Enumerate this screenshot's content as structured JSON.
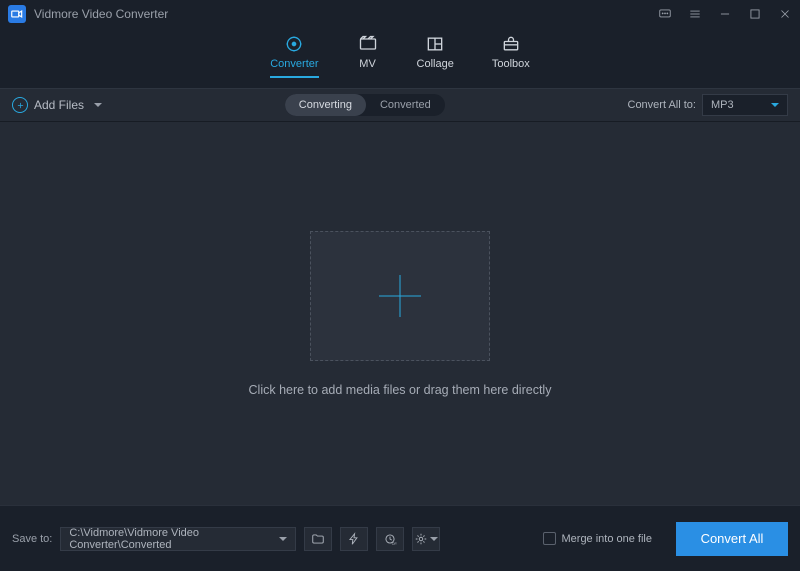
{
  "app": {
    "title": "Vidmore Video Converter"
  },
  "nav": {
    "converter": "Converter",
    "mv": "MV",
    "collage": "Collage",
    "toolbox": "Toolbox"
  },
  "toolbar": {
    "add_files": "Add Files",
    "seg_converting": "Converting",
    "seg_converted": "Converted",
    "convert_all_to": "Convert All to:",
    "format_selected": "MP3"
  },
  "workspace": {
    "hint": "Click here to add media files or drag them here directly"
  },
  "footer": {
    "save_to": "Save to:",
    "path": "C:\\Vidmore\\Vidmore Video Converter\\Converted",
    "merge": "Merge into one file",
    "convert_all": "Convert All"
  }
}
